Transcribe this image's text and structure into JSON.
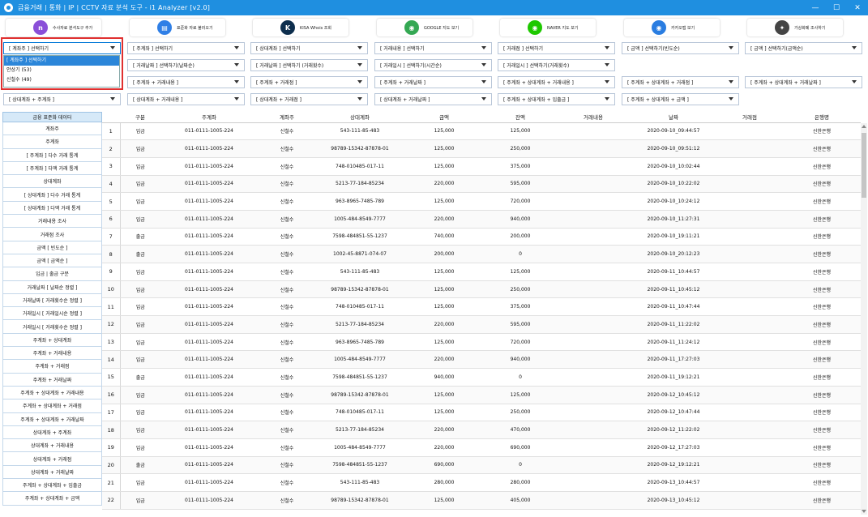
{
  "window": {
    "title": "금융거래 | 통화 | IP | CCTV 자료 분석 도구 - i1 Analyzer [v2.0]",
    "controls": [
      "—",
      "☐",
      "✕"
    ]
  },
  "toolbar": [
    {
      "label": "수사자료 분석도구 추가",
      "icon": "analysis-tool-icon",
      "color": "#8a4fd8",
      "glyph": "n"
    },
    {
      "label": "표준화 자료 불러오기",
      "icon": "document-load-icon",
      "color": "#2f7fe6",
      "glyph": "▤"
    },
    {
      "label": "KISA Whois 조회",
      "icon": "kisa-logo-icon",
      "color": "#0d2e4d",
      "glyph": "K"
    },
    {
      "label": "GOOGLE 지도 보기",
      "icon": "google-maps-icon",
      "color": "#34a853",
      "glyph": "◉"
    },
    {
      "label": "NAVER 지도 보기",
      "icon": "naver-map-icon",
      "color": "#1ec800",
      "glyph": "◉"
    },
    {
      "label": "카카오맵 보기",
      "icon": "kakao-map-icon",
      "color": "#2a7de1",
      "glyph": "◉"
    },
    {
      "label": "가상화폐 조사하기",
      "icon": "crypto-icon",
      "color": "#444444",
      "glyph": "✦"
    }
  ],
  "combos_row1": [
    "[ 계좌주 ] 선택하기",
    "[ 주계좌 ] 선택하기",
    "[ 상대계좌 ] 선택하기",
    "[ 거래내용 ] 선택하기",
    "[ 거래점 ] 선택하기",
    "[ 금액 ] 선택하기(빈도순)",
    "[ 금액 ] 선택하기(금액순)"
  ],
  "combos_row2": [
    "[ 거래날짜 ] 선택하기(날짜순)",
    "[ 거래날짜 ] 선택하기 (거래횟수)",
    "[ 거래일시 ] 선택하기(시간순)",
    "[ 거래일시 ] 선택하기(거래횟수)"
  ],
  "combos_row3": [
    "[ 주계좌 + 거래내용 ]",
    "[ 주계좌 + 거래점 ]",
    "[ 주계좌 + 거래날짜 ]",
    "[ 주계좌 + 상대계좌 + 거래내용 ]",
    "[ 주계좌 + 상대계좌 + 거래점 ]",
    "[ 주계좌 + 상대계좌 + 거래날짜 ]"
  ],
  "combos_row4": [
    "[ 상대계좌 + 주계좌 ]",
    "[ 상대계좌 + 거래내용 ]",
    "[ 상대계좌 + 거래점 ]",
    "[ 상대계좌 + 거래날짜 ]",
    "[ 주계좌 + 상대계좌 + 입출금 ]",
    "[ 주계좌 + 상대계좌 + 금액 ]"
  ],
  "dropdown": {
    "options": [
      "[ 계좌주 ] 선택하기",
      "안상기 (53)",
      "신철수 (49)"
    ],
    "selected_index": 0
  },
  "sidebar": {
    "header": "금융 표준화 데이터",
    "items": [
      "계좌주",
      "주계좌",
      "[ 주계좌 ] 다수 거래 통계",
      "[ 주계좌 ] 다액 거래 통계",
      "상대계좌",
      "[ 상대계좌 ] 다수 거래 통계",
      "[ 상대계좌 ] 다액 거래 통계",
      "거래내용 조사",
      "거래점 조사",
      "금액 [ 빈도순 ]",
      "금액 [ 금액순 ]",
      "입금 | 출금 구분",
      "거래날짜 [ 날짜순 정렬 ]",
      "거래날짜 [ 거래횟수순 정렬 ]",
      "거래일시 [ 거래일시순 정렬 ]",
      "거래일시 [ 거래횟수순 정렬 ]",
      "주계좌 + 상대계좌",
      "주계좌 + 거래내용",
      "주계좌 + 거래점",
      "주계좌 + 거래날짜",
      "주계좌 + 상대계좌 + 거래내용",
      "주계좌 + 상대계좌 + 거래점",
      "주계좌 + 상대계좌 + 거래날짜",
      "상대계좌 + 주계좌",
      "상대계좌 + 거래내용",
      "상대계좌 + 거래점",
      "상대계좌 + 거래날짜",
      "주계좌 + 상대계좌 + 입출금",
      "주계좌 + 상대계좌 + 금액"
    ]
  },
  "table": {
    "columns": [
      "",
      "구분",
      "주계좌",
      "계좌주",
      "상대계좌",
      "금액",
      "잔액",
      "거래내용",
      "날짜",
      "거래점",
      "은행명"
    ],
    "rows": [
      [
        "1",
        "입금",
        "011-0111-1005-224",
        "신철수",
        "543-111-85-483",
        "125,000",
        "125,000",
        "",
        "2020-09-10_09:44:57",
        "",
        "신한은행"
      ],
      [
        "2",
        "입금",
        "011-0111-1005-224",
        "신철수",
        "98789-15342-87878-01",
        "125,000",
        "250,000",
        "",
        "2020-09-10_09:51:12",
        "",
        "신한은행"
      ],
      [
        "3",
        "입금",
        "011-0111-1005-224",
        "신철수",
        "748-010485-017-11",
        "125,000",
        "375,000",
        "",
        "2020-09-10_10:02:44",
        "",
        "신한은행"
      ],
      [
        "4",
        "입금",
        "011-0111-1005-224",
        "신철수",
        "5213-77-184-85234",
        "220,000",
        "595,000",
        "",
        "2020-09-10_10:22:02",
        "",
        "신한은행"
      ],
      [
        "5",
        "입금",
        "011-0111-1005-224",
        "신철수",
        "963-8965-7485-789",
        "125,000",
        "720,000",
        "",
        "2020-09-10_10:24:12",
        "",
        "신한은행"
      ],
      [
        "6",
        "입금",
        "011-0111-1005-224",
        "신철수",
        "1005-484-8549-7777",
        "220,000",
        "940,000",
        "",
        "2020-09-10_11:27:31",
        "",
        "신한은행"
      ],
      [
        "7",
        "출금",
        "011-0111-1005-224",
        "신철수",
        "7598-484851-55-1237",
        "740,000",
        "200,000",
        "",
        "2020-09-10_19:11:21",
        "",
        "신한은행"
      ],
      [
        "8",
        "출금",
        "011-0111-1005-224",
        "신철수",
        "1002-45-8871-074-07",
        "200,000",
        "0",
        "",
        "2020-09-10_20:12:23",
        "",
        "신한은행"
      ],
      [
        "9",
        "입금",
        "011-0111-1005-224",
        "신철수",
        "543-111-85-483",
        "125,000",
        "125,000",
        "",
        "2020-09-11_10:44:57",
        "",
        "신한은행"
      ],
      [
        "10",
        "입금",
        "011-0111-1005-224",
        "신철수",
        "98789-15342-87878-01",
        "125,000",
        "250,000",
        "",
        "2020-09-11_10:45:12",
        "",
        "신한은행"
      ],
      [
        "11",
        "입금",
        "011-0111-1005-224",
        "신철수",
        "748-010485-017-11",
        "125,000",
        "375,000",
        "",
        "2020-09-11_10:47:44",
        "",
        "신한은행"
      ],
      [
        "12",
        "입금",
        "011-0111-1005-224",
        "신철수",
        "5213-77-184-85234",
        "220,000",
        "595,000",
        "",
        "2020-09-11_11:22:02",
        "",
        "신한은행"
      ],
      [
        "13",
        "입금",
        "011-0111-1005-224",
        "신철수",
        "963-8965-7485-789",
        "125,000",
        "720,000",
        "",
        "2020-09-11_11:24:12",
        "",
        "신한은행"
      ],
      [
        "14",
        "입금",
        "011-0111-1005-224",
        "신철수",
        "1005-484-8549-7777",
        "220,000",
        "940,000",
        "",
        "2020-09-11_17:27:03",
        "",
        "신한은행"
      ],
      [
        "15",
        "출금",
        "011-0111-1005-224",
        "신철수",
        "7598-484851-55-1237",
        "940,000",
        "0",
        "",
        "2020-09-11_19:12:21",
        "",
        "신한은행"
      ],
      [
        "16",
        "입금",
        "011-0111-1005-224",
        "신철수",
        "98789-15342-87878-01",
        "125,000",
        "125,000",
        "",
        "2020-09-12_10:45:12",
        "",
        "신한은행"
      ],
      [
        "17",
        "입금",
        "011-0111-1005-224",
        "신철수",
        "748-010485-017-11",
        "125,000",
        "250,000",
        "",
        "2020-09-12_10:47:44",
        "",
        "신한은행"
      ],
      [
        "18",
        "입금",
        "011-0111-1005-224",
        "신철수",
        "5213-77-184-85234",
        "220,000",
        "470,000",
        "",
        "2020-09-12_11:22:02",
        "",
        "신한은행"
      ],
      [
        "19",
        "입금",
        "011-0111-1005-224",
        "신철수",
        "1005-484-8549-7777",
        "220,000",
        "690,000",
        "",
        "2020-09-12_17:27:03",
        "",
        "신한은행"
      ],
      [
        "20",
        "출금",
        "011-0111-1005-224",
        "신철수",
        "7598-484851-55-1237",
        "690,000",
        "0",
        "",
        "2020-09-12_19:12:21",
        "",
        "신한은행"
      ],
      [
        "21",
        "입금",
        "011-0111-1005-224",
        "신철수",
        "543-111-85-483",
        "280,000",
        "280,000",
        "",
        "2020-09-13_10:44:57",
        "",
        "신한은행"
      ],
      [
        "22",
        "입금",
        "011-0111-1005-224",
        "신철수",
        "98789-15342-87878-01",
        "125,000",
        "405,000",
        "",
        "2020-09-13_10:45:12",
        "",
        "신한은행"
      ]
    ]
  }
}
